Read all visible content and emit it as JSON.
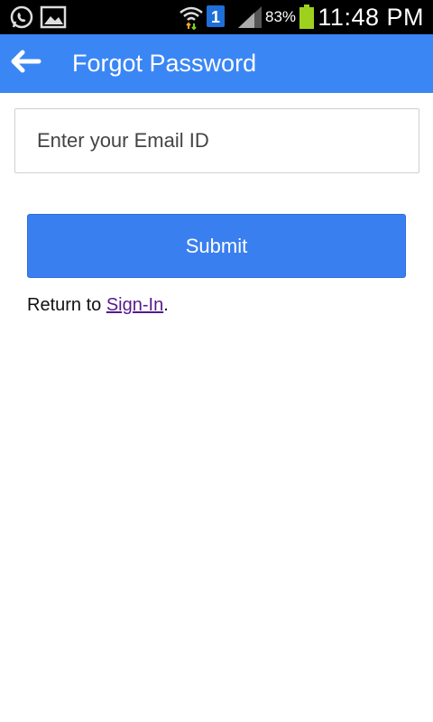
{
  "status_bar": {
    "battery_percent": "83%",
    "time": "11:48 PM",
    "icons": [
      "whatsapp-icon",
      "gallery-icon",
      "wifi-icon",
      "notification-badge-icon",
      "signal-icon",
      "battery-icon"
    ],
    "notification_badge": "1",
    "battery_color": "#9ed11d"
  },
  "app_bar": {
    "title": "Forgot Password",
    "back_icon": "arrow-left-icon",
    "background_color": "#3a86f5"
  },
  "form": {
    "email_placeholder": "Enter your Email ID",
    "email_value": "",
    "submit_label": "Submit",
    "return_prefix": "Return to ",
    "signin_link": "Sign-In",
    "return_suffix": "."
  }
}
